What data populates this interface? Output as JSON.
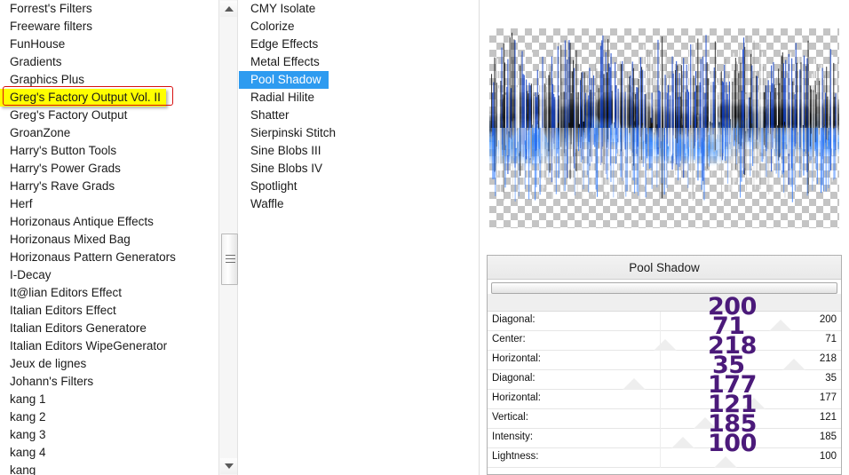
{
  "left_list": {
    "name": "filter-category-list",
    "items": [
      {
        "label": "Forrest's Filters",
        "state": "normal"
      },
      {
        "label": "Freeware filters",
        "state": "normal"
      },
      {
        "label": "FunHouse",
        "state": "normal"
      },
      {
        "label": "Gradients",
        "state": "normal"
      },
      {
        "label": "Graphics Plus",
        "state": "normal"
      },
      {
        "label": "Greg's Factory Output Vol. II",
        "state": "highlighted"
      },
      {
        "label": "Greg's Factory Output",
        "state": "normal"
      },
      {
        "label": "GroanZone",
        "state": "normal"
      },
      {
        "label": "Harry's Button Tools",
        "state": "normal"
      },
      {
        "label": "Harry's Power Grads",
        "state": "normal"
      },
      {
        "label": "Harry's Rave Grads",
        "state": "normal"
      },
      {
        "label": "Herf",
        "state": "normal"
      },
      {
        "label": "Horizonaus Antique Effects",
        "state": "normal"
      },
      {
        "label": "Horizonaus Mixed Bag",
        "state": "normal"
      },
      {
        "label": "Horizonaus Pattern Generators",
        "state": "normal"
      },
      {
        "label": "I-Decay",
        "state": "normal"
      },
      {
        "label": "It@lian Editors Effect",
        "state": "normal"
      },
      {
        "label": "Italian Editors Effect",
        "state": "normal"
      },
      {
        "label": "Italian Editors Generatore",
        "state": "normal"
      },
      {
        "label": "Italian Editors WipeGenerator",
        "state": "normal"
      },
      {
        "label": "Jeux de lignes",
        "state": "normal"
      },
      {
        "label": "Johann's Filters",
        "state": "normal"
      },
      {
        "label": "kang 1",
        "state": "normal"
      },
      {
        "label": "kang 2",
        "state": "normal"
      },
      {
        "label": "kang 3",
        "state": "normal"
      },
      {
        "label": "kang 4",
        "state": "normal"
      },
      {
        "label": "kang",
        "state": "clipped"
      }
    ],
    "highlight_color": "#ffff00",
    "annotation_border_color": "#d81010"
  },
  "left_scrollbar": {
    "up_icon": "scroll-up-arrow-icon",
    "down_icon": "scroll-down-arrow-icon",
    "thumb_icon": "scrollbar-grip-icon"
  },
  "middle_list": {
    "name": "effect-list",
    "selected": "Pool Shadow",
    "selection_color": "#2e9bf0",
    "items": [
      {
        "label": "CMY Isolate"
      },
      {
        "label": "Colorize"
      },
      {
        "label": "Edge Effects"
      },
      {
        "label": "Metal Effects"
      },
      {
        "label": "Pool Shadow"
      },
      {
        "label": "Radial Hilite"
      },
      {
        "label": "Shatter"
      },
      {
        "label": "Sierpinski Stitch"
      },
      {
        "label": "Sine Blobs III"
      },
      {
        "label": "Sine Blobs IV"
      },
      {
        "label": "Spotlight"
      },
      {
        "label": "Waffle"
      }
    ]
  },
  "preview": {
    "name": "effect-preview",
    "description": "waveform-image-preview",
    "transparency_checker": true
  },
  "params": {
    "title": "Pool Shadow",
    "value_color": "#4b1a7a",
    "rows": [
      {
        "label": "",
        "value": "",
        "big": "200",
        "thumb_pct": 92
      },
      {
        "label": "Diagonal:",
        "value": "200",
        "big": "71",
        "thumb_pct": 80
      },
      {
        "label": "Center:",
        "value": "71",
        "big": "218",
        "thumb_pct": 28
      },
      {
        "label": "Horizontal:",
        "value": "218",
        "big": "35",
        "thumb_pct": 86
      },
      {
        "label": "Diagonal:",
        "value": "35",
        "big": "177",
        "thumb_pct": 14
      },
      {
        "label": "Horizontal:",
        "value": "177",
        "big": "121",
        "thumb_pct": 68
      },
      {
        "label": "Vertical:",
        "value": "121",
        "big": "185",
        "thumb_pct": 46
      },
      {
        "label": "Intensity:",
        "value": "185",
        "big": "100",
        "thumb_pct": 36
      },
      {
        "label": "Lightness:",
        "value": "100",
        "big": "",
        "thumb_pct": 55
      }
    ]
  }
}
